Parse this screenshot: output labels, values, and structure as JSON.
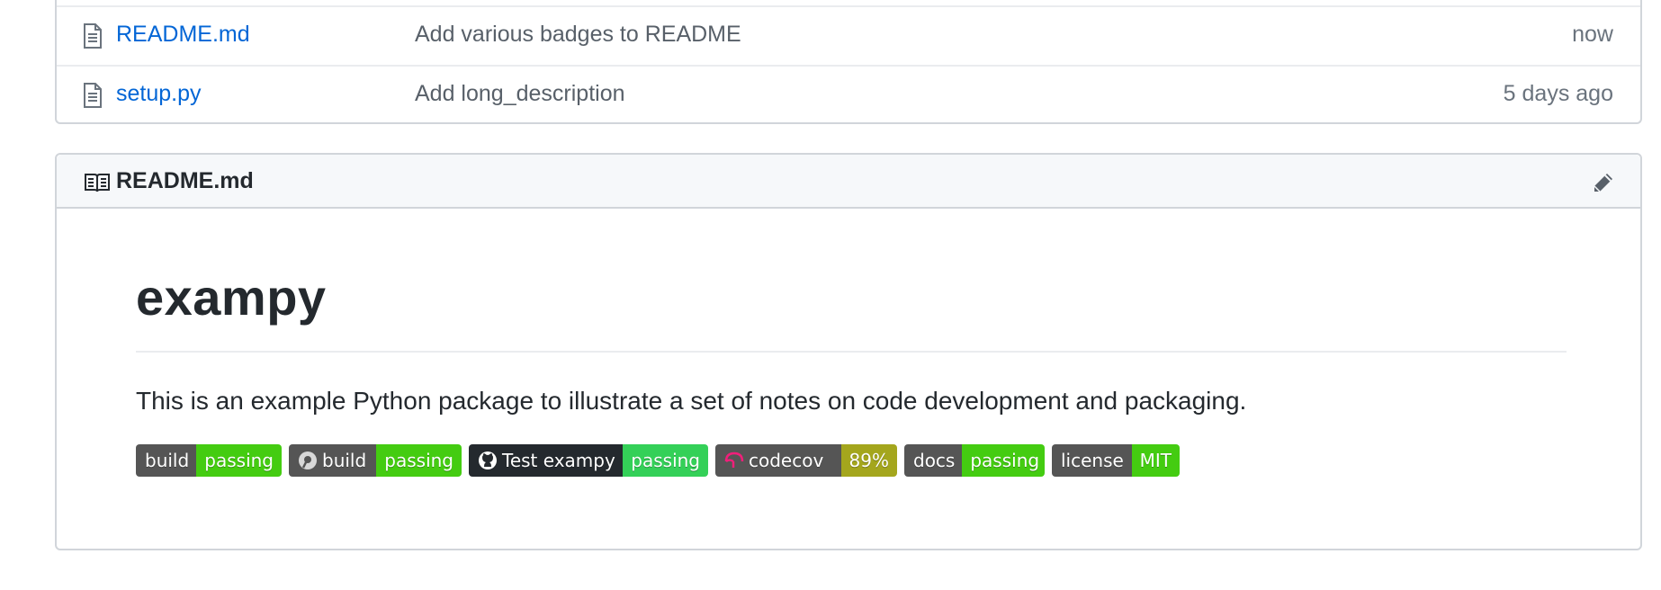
{
  "files": [
    {
      "name": "README.md",
      "message": "Add various badges to README",
      "age": "now"
    },
    {
      "name": "setup.py",
      "message": "Add long_description",
      "age": "5 days ago"
    }
  ],
  "readme": {
    "header_title": "README.md",
    "heading": "exampy",
    "description": "This is an example Python package to illustrate a set of notes on code development and packaging.",
    "badges": [
      {
        "label": "build",
        "value": "passing",
        "value_color": "#4c1"
      },
      {
        "label": "build",
        "value": "passing",
        "value_color": "#4c1",
        "icon": "appveyor-icon"
      },
      {
        "label": "Test exampy",
        "value": "passing",
        "value_color": "#34d058",
        "icon": "github-icon"
      },
      {
        "label": "codecov",
        "value": "89%",
        "value_color": "#a4a61d",
        "icon": "codecov-icon"
      },
      {
        "label": "docs",
        "value": "passing",
        "value_color": "#4c1"
      },
      {
        "label": "license",
        "value": "MIT",
        "value_color": "#4c1"
      }
    ]
  },
  "colors": {
    "link": "#0366d6",
    "border": "#d1d5da",
    "header_bg": "#f6f8fa"
  }
}
